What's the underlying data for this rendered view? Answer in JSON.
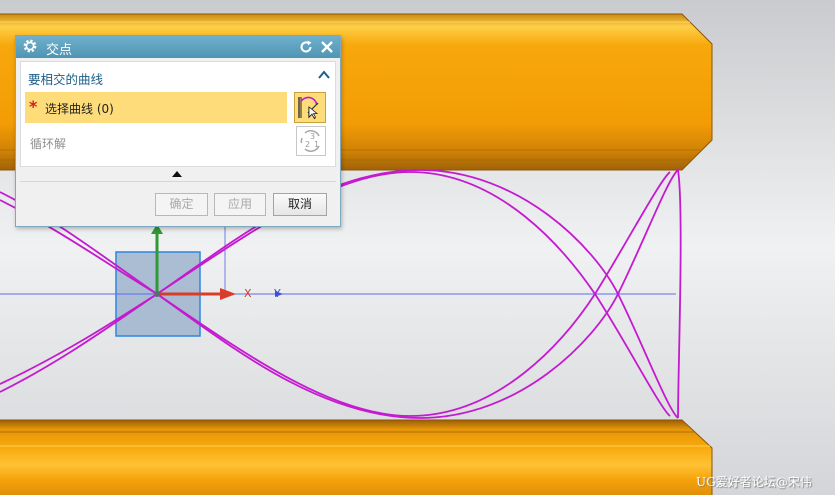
{
  "colors": {
    "title_bar": "#4f95b3",
    "section_header": "#1d5f88",
    "highlight_row": "#ffdc7a",
    "required_star": "#d21e1e",
    "curve": "#c41ad0",
    "solid_orange": "#f5a10a",
    "datum_plane": "#9fb4cc",
    "x_axis": "#d83c2a",
    "y_axis": "#3a4fe0",
    "z_axis": "#2f9a35"
  },
  "dialog": {
    "title": "交点",
    "title_icon": "gear-icon",
    "reset_icon": "reset-icon",
    "close_icon": "close-icon",
    "section": {
      "header": "要相交的曲线",
      "collapse_icon": "chevron-up-icon",
      "select_curve": {
        "required_mark": "*",
        "label": "选择曲线 (0)",
        "icon": "select-curve-icon"
      },
      "cycle": {
        "label": "循环解",
        "icon": "cycle-solution-icon"
      }
    },
    "more_icon": "triangle-up-icon",
    "buttons": {
      "ok": "确定",
      "apply": "应用",
      "cancel": "取消"
    }
  },
  "viewport": {
    "axis_x_label": "X",
    "axis_y_label": "Y",
    "watermark": "UG爱好者论坛@宋伟"
  }
}
